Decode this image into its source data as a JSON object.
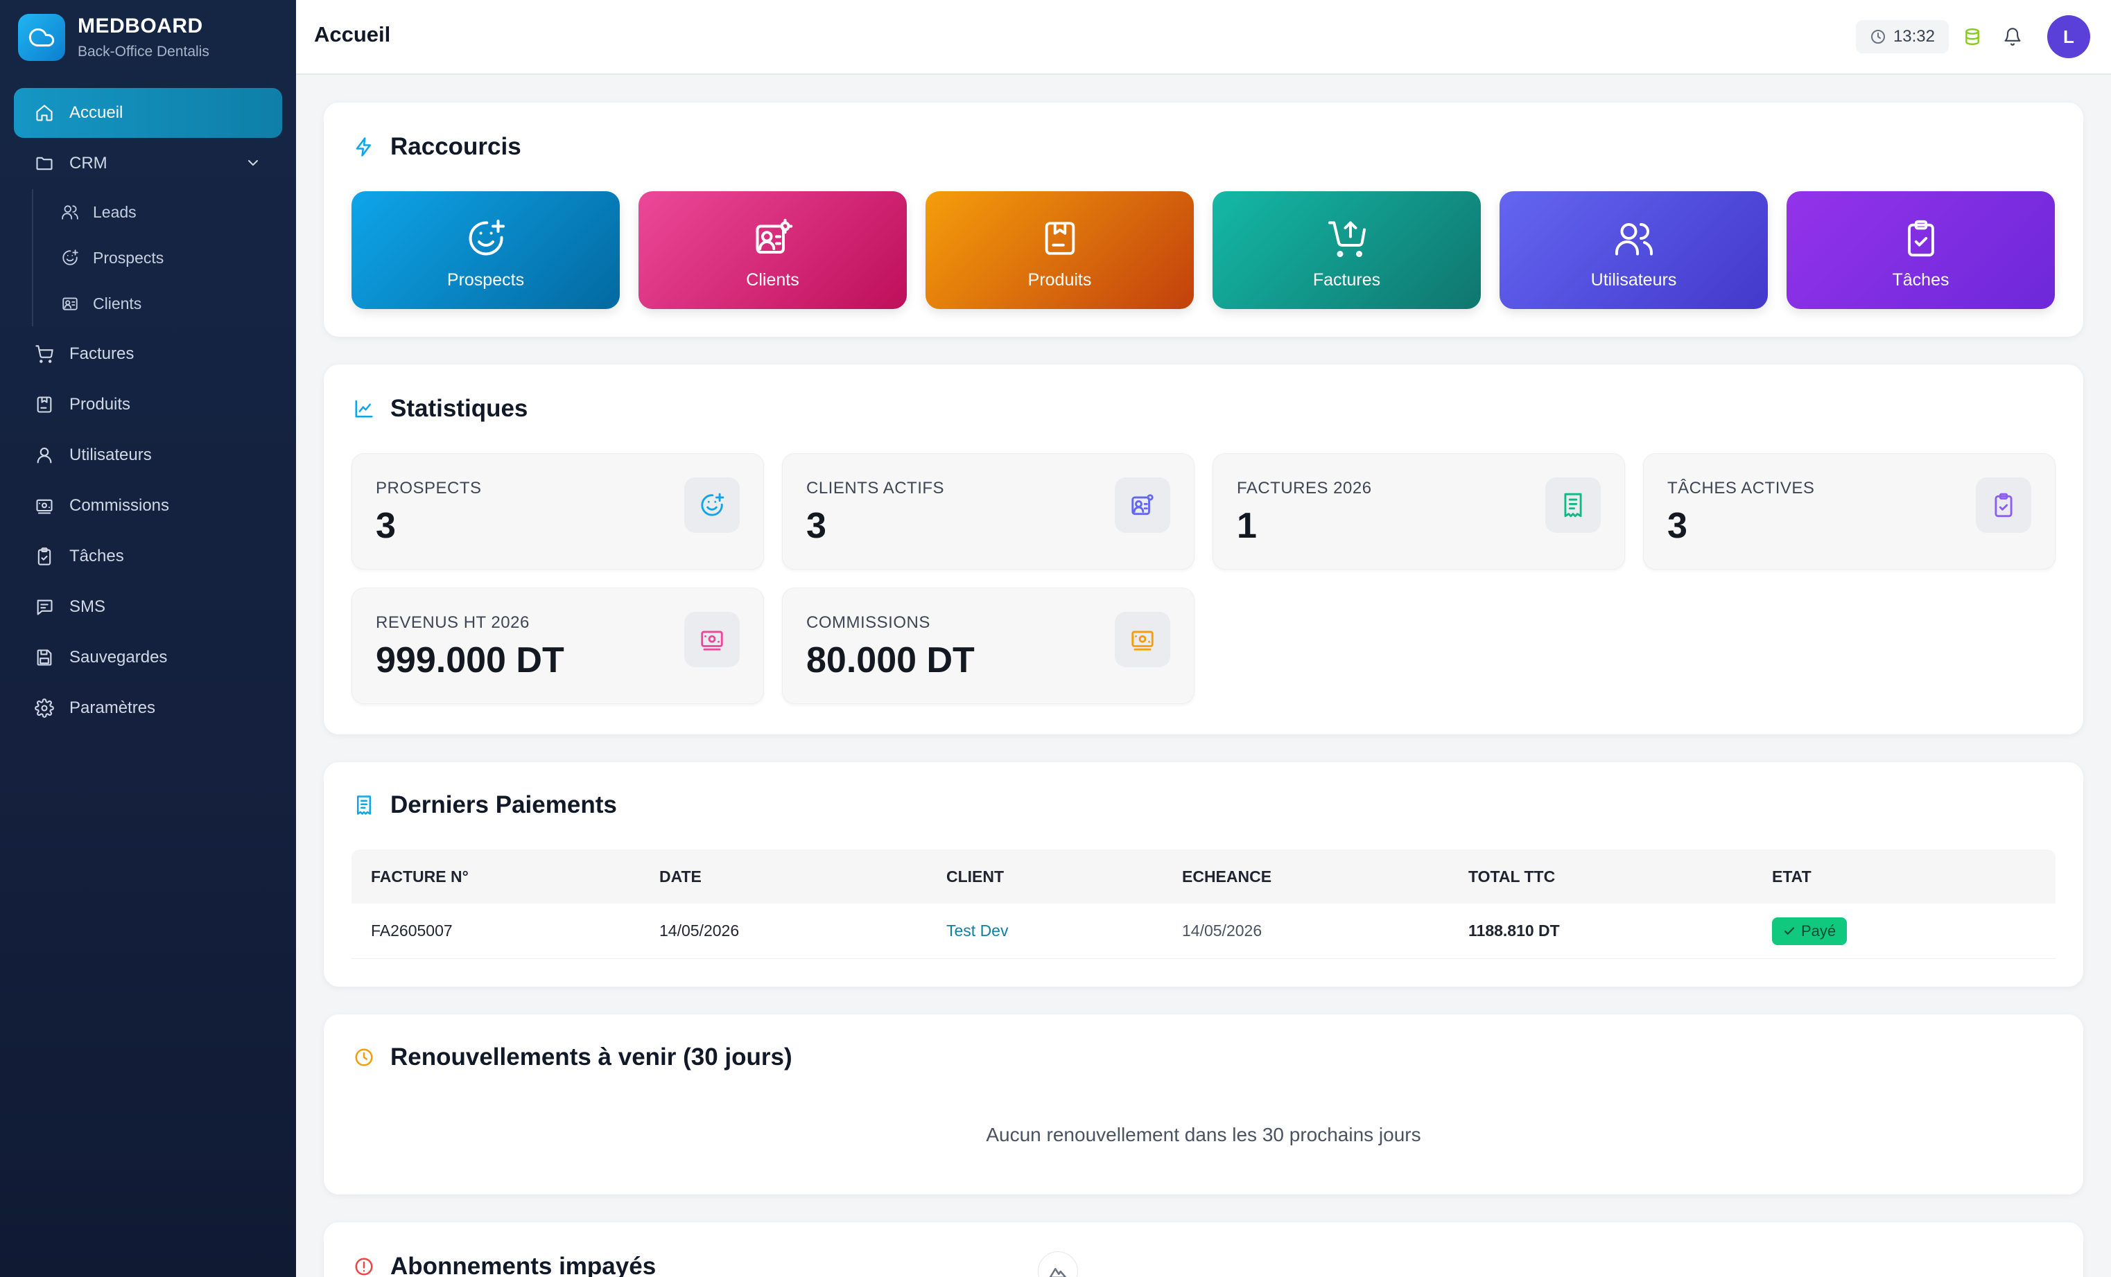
{
  "brand": {
    "title": "MEDBOARD",
    "subtitle": "Back-Office Dentalis"
  },
  "sidebar": {
    "items": [
      {
        "label": "Accueil",
        "icon": "home-icon",
        "active": true
      },
      {
        "label": "CRM",
        "icon": "folder-icon",
        "expanded": true
      },
      {
        "label": "Factures",
        "icon": "cart-icon"
      },
      {
        "label": "Produits",
        "icon": "box-icon"
      },
      {
        "label": "Utilisateurs",
        "icon": "user-icon"
      },
      {
        "label": "Commissions",
        "icon": "money-icon"
      },
      {
        "label": "Tâches",
        "icon": "clipboard-icon"
      },
      {
        "label": "SMS",
        "icon": "message-icon"
      },
      {
        "label": "Sauvegardes",
        "icon": "save-icon"
      },
      {
        "label": "Paramètres",
        "icon": "gear-icon"
      }
    ],
    "crm_sub": [
      {
        "label": "Leads",
        "icon": "users-icon"
      },
      {
        "label": "Prospects",
        "icon": "smile-plus-icon"
      },
      {
        "label": "Clients",
        "icon": "contact-card-icon"
      }
    ]
  },
  "header": {
    "title": "Accueil",
    "time": "13:32",
    "avatar_initial": "L"
  },
  "shortcuts": {
    "title": "Raccourcis",
    "items": [
      {
        "label": "Prospects",
        "icon": "smile-plus-icon",
        "color_from": "#0ea5e9",
        "color_to": "#0369a1"
      },
      {
        "label": "Clients",
        "icon": "contact-card-icon",
        "color_from": "#ec4899",
        "color_to": "#be0f5a"
      },
      {
        "label": "Produits",
        "icon": "box-icon",
        "color_from": "#f59e0b",
        "color_to": "#c2410c"
      },
      {
        "label": "Factures",
        "icon": "cart-icon",
        "color_from": "#14b8a6",
        "color_to": "#0f766e"
      },
      {
        "label": "Utilisateurs",
        "icon": "users-icon",
        "color_from": "#6366f1",
        "color_to": "#4338ca"
      },
      {
        "label": "Tâches",
        "icon": "clipboard-icon",
        "color_from": "#9333ea",
        "color_to": "#6d28d9"
      }
    ]
  },
  "stats": {
    "title": "Statistiques",
    "items": [
      {
        "label": "PROSPECTS",
        "value": "3",
        "icon": "smile-plus-icon",
        "color": "#0ea5e9"
      },
      {
        "label": "CLIENTS ACTIFS",
        "value": "3",
        "icon": "contact-card-icon",
        "color": "#6366f1"
      },
      {
        "label": "FACTURES 2026",
        "value": "1",
        "icon": "receipt-icon",
        "color": "#10b981"
      },
      {
        "label": "TÂCHES ACTIVES",
        "value": "3",
        "icon": "clipboard-icon",
        "color": "#8b5cf6"
      },
      {
        "label": "REVENUS HT 2026",
        "value": "999.000 DT",
        "icon": "money-icon",
        "color": "#ec4899"
      },
      {
        "label": "COMMISSIONS",
        "value": "80.000 DT",
        "icon": "money-icon",
        "color": "#f59e0b"
      }
    ]
  },
  "payments": {
    "title": "Derniers Paiements",
    "columns": [
      "FACTURE N°",
      "DATE",
      "CLIENT",
      "ECHEANCE",
      "TOTAL TTC",
      "ETAT"
    ],
    "rows": [
      {
        "invoice": "FA2605007",
        "date": "14/05/2026",
        "client": "Test Dev",
        "due": "14/05/2026",
        "total": "1188.810 DT",
        "status": "Payé"
      }
    ]
  },
  "renewals": {
    "title": "Renouvellements à venir (30 jours)",
    "empty": "Aucun renouvellement dans les 30 prochains jours"
  },
  "unpaid": {
    "title": "Abonnements impayés"
  },
  "colors": {
    "accent": "#0e8fb8",
    "sidebar_bg": "#14213d",
    "paid": "#10c97f"
  }
}
